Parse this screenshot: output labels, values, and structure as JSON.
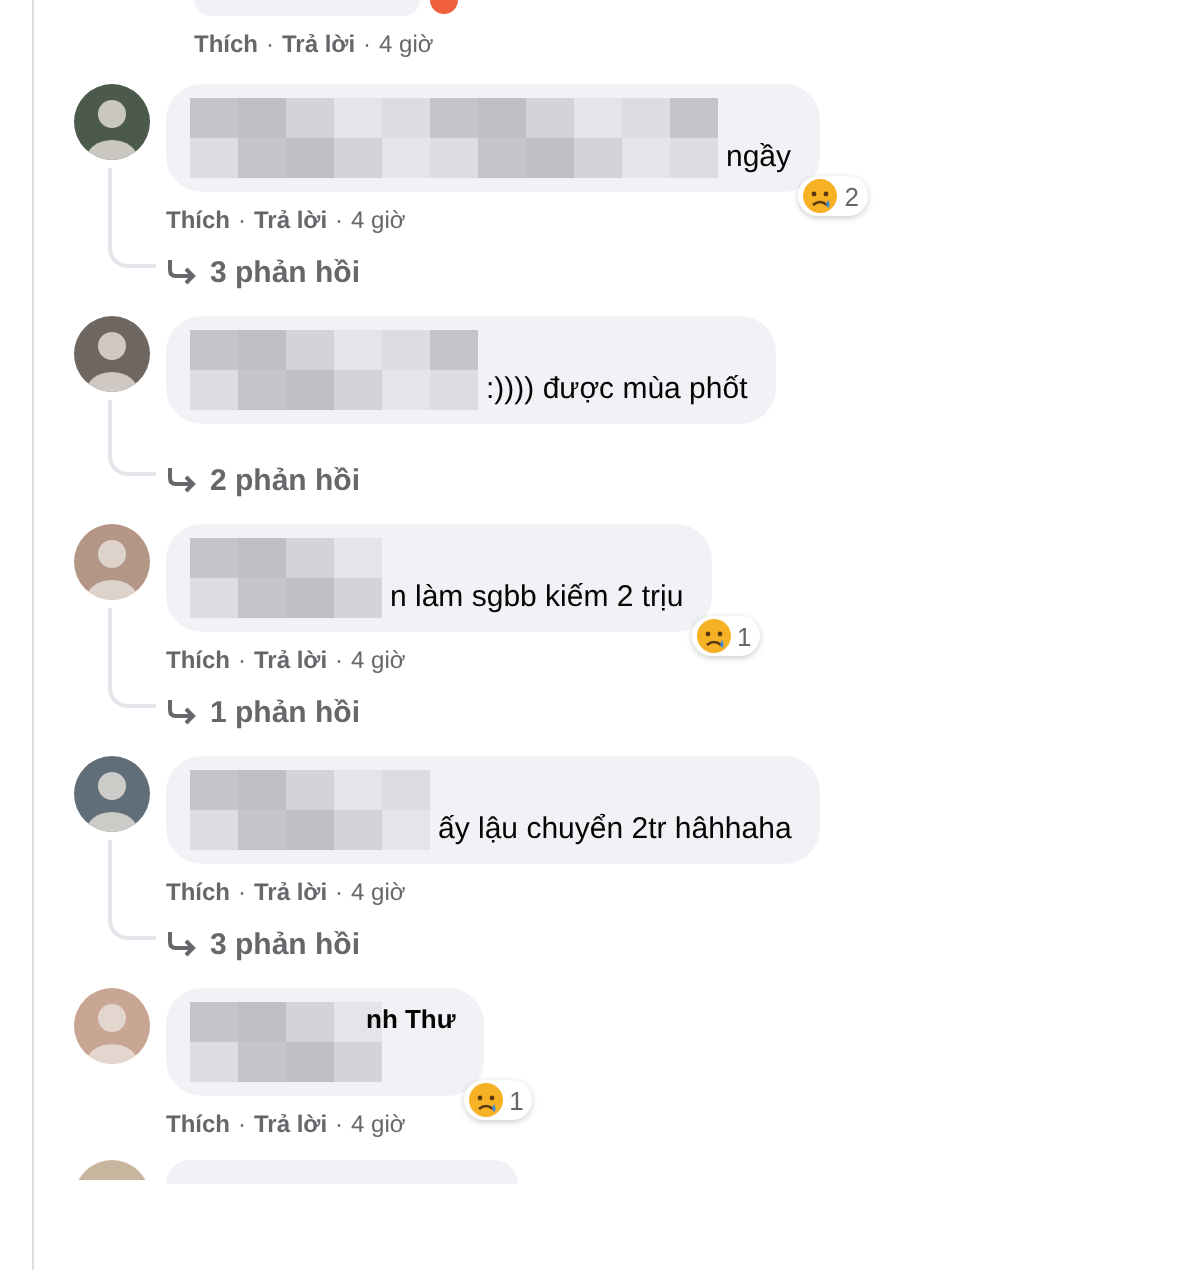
{
  "comments": [
    {
      "kind": "cut_top",
      "actions": [
        {
          "kind": "link",
          "label": "Thích"
        },
        {
          "kind": "dot",
          "label": "·"
        },
        {
          "kind": "link",
          "label": "Trả lời"
        },
        {
          "kind": "dot",
          "label": "·"
        },
        {
          "kind": "time",
          "label": "4 giờ"
        }
      ]
    },
    {
      "kind": "comment",
      "text": "ngầy",
      "reaction": {
        "count": "2"
      },
      "actions": [
        {
          "kind": "link",
          "label": "Thích"
        },
        {
          "kind": "dot",
          "label": "·"
        },
        {
          "kind": "link",
          "label": "Trả lời"
        },
        {
          "kind": "dot",
          "label": "·"
        },
        {
          "kind": "time",
          "label": "4 giờ"
        }
      ],
      "replies": "3 phản hồi"
    },
    {
      "kind": "comment",
      "text": ":)))) được mùa phốt",
      "replies": "2 phản hồi"
    },
    {
      "kind": "comment",
      "text": "n làm sgbb kiếm 2 trịu",
      "reaction": {
        "count": "1"
      },
      "actions": [
        {
          "kind": "link",
          "label": "Thích"
        },
        {
          "kind": "dot",
          "label": "·"
        },
        {
          "kind": "link",
          "label": "Trả lời"
        },
        {
          "kind": "dot",
          "label": "·"
        },
        {
          "kind": "time",
          "label": "4 giờ"
        }
      ],
      "replies": "1 phản hồi"
    },
    {
      "kind": "comment",
      "text": "ấy lậu chuyển 2tr hâhhaha",
      "actions": [
        {
          "kind": "link",
          "label": "Thích"
        },
        {
          "kind": "dot",
          "label": "·"
        },
        {
          "kind": "link",
          "label": "Trả lời"
        },
        {
          "kind": "dot",
          "label": "·"
        },
        {
          "kind": "time",
          "label": "4 giờ"
        }
      ],
      "replies": "3 phản hồi"
    },
    {
      "kind": "comment",
      "name": "nh Thư",
      "reaction": {
        "count": "1"
      },
      "actions": [
        {
          "kind": "link",
          "label": "Thích"
        },
        {
          "kind": "dot",
          "label": "·"
        },
        {
          "kind": "link",
          "label": "Trả lời"
        },
        {
          "kind": "dot",
          "label": "·"
        },
        {
          "kind": "time",
          "label": "4 giờ"
        }
      ]
    },
    {
      "kind": "cut_bottom"
    }
  ]
}
